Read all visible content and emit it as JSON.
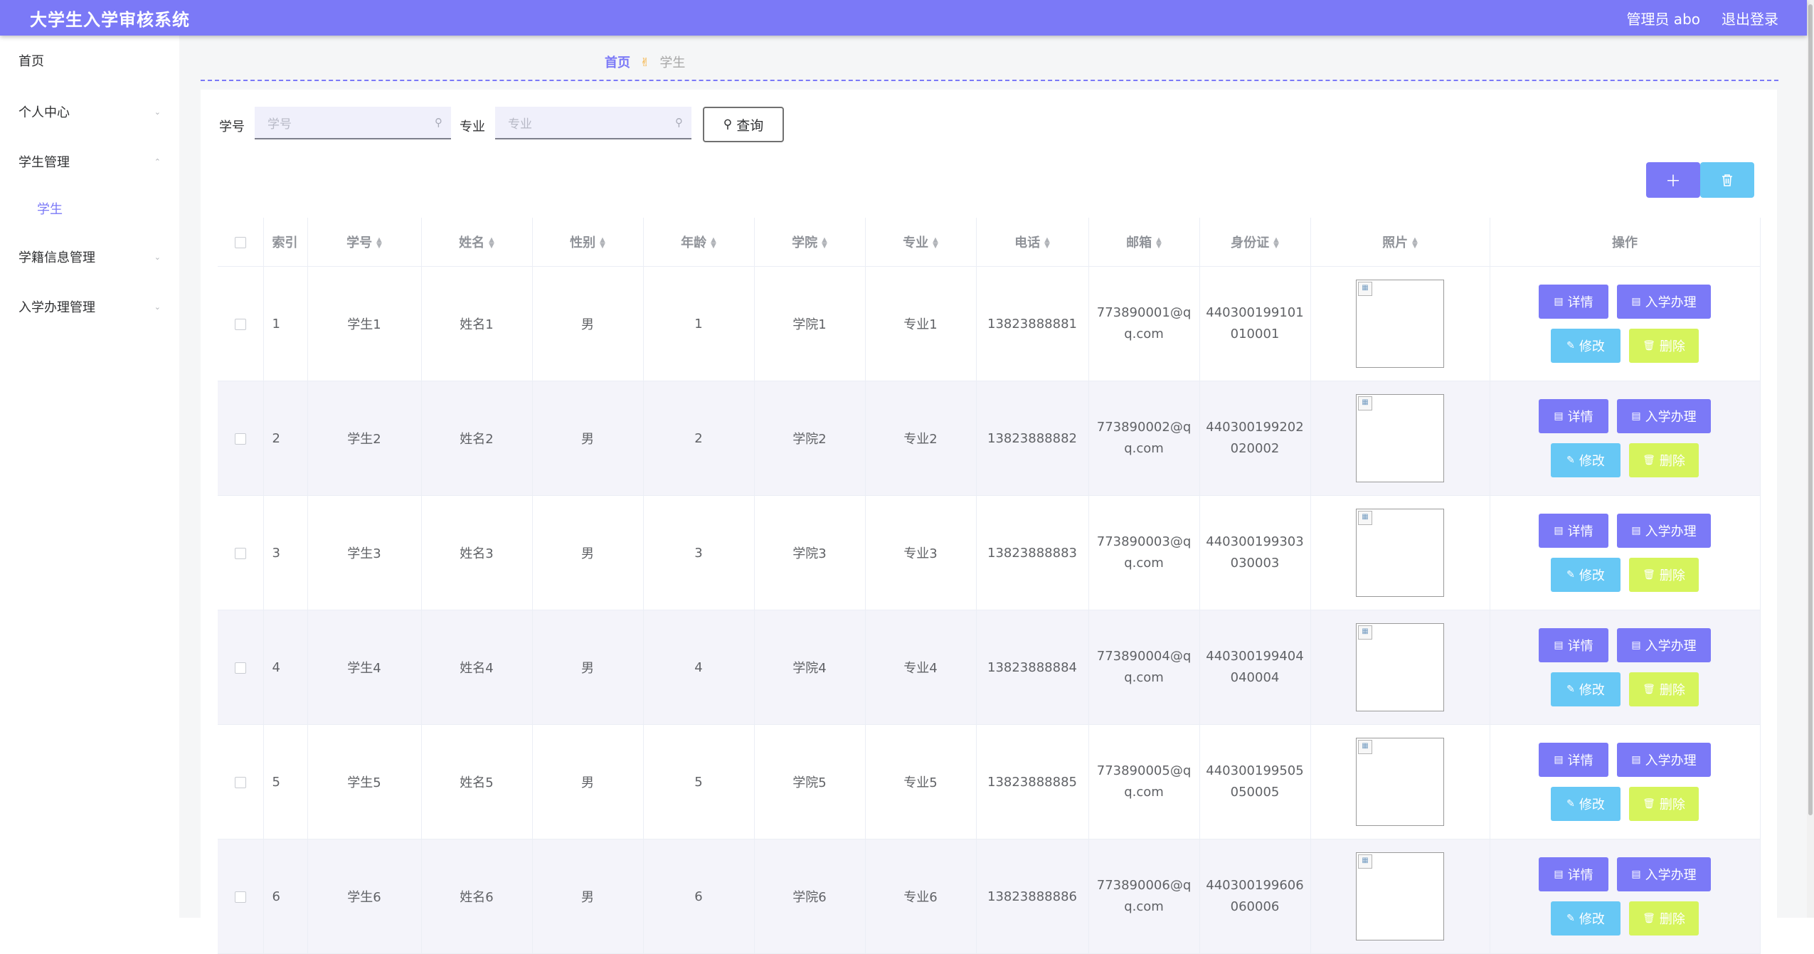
{
  "header": {
    "title": "大学生入学审核系统",
    "user": "管理员 abo",
    "logout": "退出登录"
  },
  "sidebar": {
    "items": [
      {
        "label": "首页",
        "chevron": false
      },
      {
        "label": "个人中心",
        "chevron": "down"
      },
      {
        "label": "学生管理",
        "chevron": "up"
      },
      {
        "label": "学生",
        "sub": true
      },
      {
        "label": "学籍信息管理",
        "chevron": "down"
      },
      {
        "label": "入学办理管理",
        "chevron": "down"
      }
    ]
  },
  "breadcrumb": {
    "home": "首页",
    "current": "学生",
    "separator_icon": "hand-peace-icon"
  },
  "search": {
    "fields": [
      {
        "label": "学号",
        "placeholder": "学号"
      },
      {
        "label": "专业",
        "placeholder": "专业"
      }
    ],
    "query_label": "查询"
  },
  "toolbar": {
    "add_icon": "plus-icon",
    "delete_icon": "trash-icon"
  },
  "table": {
    "columns": [
      "索引",
      "学号",
      "姓名",
      "性别",
      "年龄",
      "学院",
      "专业",
      "电话",
      "邮箱",
      "身份证",
      "照片",
      "操作"
    ],
    "rows": [
      {
        "index": "1",
        "student_no": "学生1",
        "name": "姓名1",
        "gender": "男",
        "age": "1",
        "college": "学院1",
        "major": "专业1",
        "phone": "13823888881",
        "email": [
          "773890001@q",
          "q.com"
        ],
        "id_card": [
          "440300199101",
          "010001"
        ]
      },
      {
        "index": "2",
        "student_no": "学生2",
        "name": "姓名2",
        "gender": "男",
        "age": "2",
        "college": "学院2",
        "major": "专业2",
        "phone": "13823888882",
        "email": [
          "773890002@q",
          "q.com"
        ],
        "id_card": [
          "440300199202",
          "020002"
        ]
      },
      {
        "index": "3",
        "student_no": "学生3",
        "name": "姓名3",
        "gender": "男",
        "age": "3",
        "college": "学院3",
        "major": "专业3",
        "phone": "13823888883",
        "email": [
          "773890003@q",
          "q.com"
        ],
        "id_card": [
          "440300199303",
          "030003"
        ]
      },
      {
        "index": "4",
        "student_no": "学生4",
        "name": "姓名4",
        "gender": "男",
        "age": "4",
        "college": "学院4",
        "major": "专业4",
        "phone": "13823888884",
        "email": [
          "773890004@q",
          "q.com"
        ],
        "id_card": [
          "440300199404",
          "040004"
        ]
      },
      {
        "index": "5",
        "student_no": "学生5",
        "name": "姓名5",
        "gender": "男",
        "age": "5",
        "college": "学院5",
        "major": "专业5",
        "phone": "13823888885",
        "email": [
          "773890005@q",
          "q.com"
        ],
        "id_card": [
          "440300199505",
          "050005"
        ]
      },
      {
        "index": "6",
        "student_no": "学生6",
        "name": "姓名6",
        "gender": "男",
        "age": "6",
        "college": "学院6",
        "major": "专业6",
        "phone": "13823888886",
        "email": [
          "773890006@q",
          "q.com"
        ],
        "id_card": [
          "440300199606",
          "060006"
        ]
      }
    ],
    "actions": {
      "detail": "详情",
      "admit": "入学办理",
      "edit": "修改",
      "delete": "删除"
    }
  },
  "colors": {
    "primary": "#7b79f7",
    "info": "#67c8f5",
    "lime": "#d6f45c",
    "stripe": "#f4f4fa"
  }
}
